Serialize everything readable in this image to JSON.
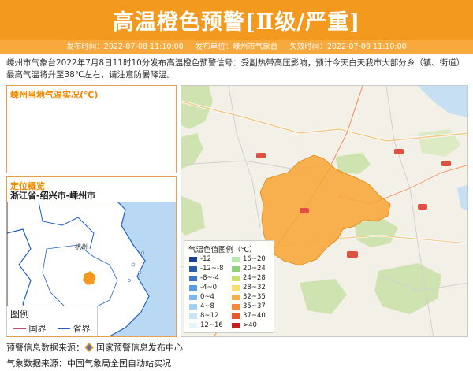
{
  "header": {
    "title": "高温橙色预警[Ⅱ级/严重]",
    "publish_time_label": "发布时间：",
    "publish_time": "2022-07-08 11:10:00",
    "publisher_label": "发布单位：",
    "publisher": "嵊州市气象台",
    "expire_label": "失效时间：",
    "expire_time": "2022-07-09 11:10:00"
  },
  "description": "嵊州市气象台2022年7月8日11时10分发布高温橙色预警信号：受副热带高压影响，预计今天白天我市大部分乡（镇、街道）最高气温将升至38℃左右，请注意防暑降温。",
  "temp_panel": {
    "title": "嵊州当地气温实况(℃)"
  },
  "location_panel": {
    "title": "定位概览",
    "location": "浙江省-绍兴市-嵊州市",
    "map_labels": {
      "hangzhou": "杭州"
    }
  },
  "mini_legend": {
    "title": "图例",
    "items": [
      {
        "label": "国界",
        "color": "#c0507a"
      },
      {
        "label": "省界",
        "color": "#2060c0"
      }
    ]
  },
  "temp_legend": {
    "title": "气温色值图例（℃）",
    "left": [
      {
        "label": "-12",
        "color": "#1a3f8c"
      },
      {
        "label": "-12~-8",
        "color": "#2a5aa8"
      },
      {
        "label": "-8~-4",
        "color": "#3c78c8"
      },
      {
        "label": "-4~0",
        "color": "#5a9ae0"
      },
      {
        "label": "0~4",
        "color": "#7eb8ef"
      },
      {
        "label": "4~8",
        "color": "#a4d0f4"
      },
      {
        "label": "8~12",
        "color": "#c8e6f8"
      },
      {
        "label": "12~16",
        "color": "#e6f4fc"
      }
    ],
    "right": [
      {
        "label": "16~20",
        "color": "#b8e8b0"
      },
      {
        "label": "20~24",
        "color": "#8ed07c"
      },
      {
        "label": "24~28",
        "color": "#c8e070"
      },
      {
        "label": "28~32",
        "color": "#f4e06a"
      },
      {
        "label": "32~35",
        "color": "#f6b048"
      },
      {
        "label": "35~37",
        "color": "#f28a3a"
      },
      {
        "label": "37~40",
        "color": "#e85a2a"
      },
      {
        "label": ">40",
        "color": "#c81e1e"
      }
    ]
  },
  "sources": {
    "warning_source_label": "预警信息数据来源：",
    "warning_source": "国家预警信息发布中心",
    "weather_source_label": "气象数据来源：",
    "weather_source": "中国气象局全国自动站实况"
  }
}
